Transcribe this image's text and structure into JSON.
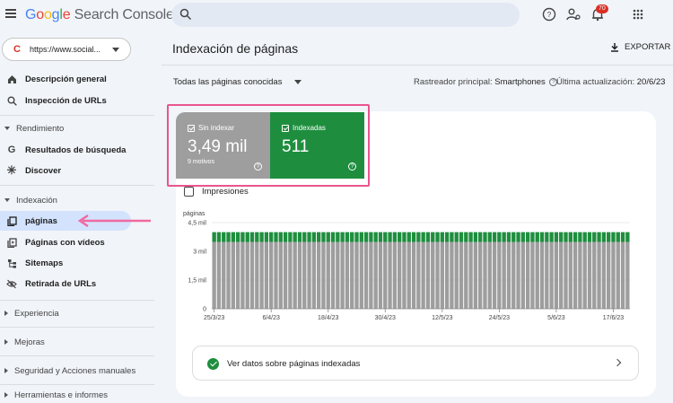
{
  "header": {
    "logo_google": "Google",
    "logo_product": "Search Console",
    "search_placeholder": "",
    "notification_count": "70"
  },
  "sidebar": {
    "property": "https://www.social...",
    "items_top": [
      {
        "label": "Descripción general",
        "icon": "home-icon"
      },
      {
        "label": "Inspección de URLs",
        "icon": "search-icon"
      }
    ],
    "section_rendimiento": "Rendimiento",
    "items_rendimiento": [
      {
        "label": "Resultados de búsqueda",
        "icon": "google-g-icon"
      },
      {
        "label": "Discover",
        "icon": "asterisk-icon"
      }
    ],
    "section_indexacion": "Indexación",
    "items_indexacion": [
      {
        "label": "páginas",
        "icon": "pages-icon"
      },
      {
        "label": "Páginas con vídeos",
        "icon": "video-pages-icon"
      },
      {
        "label": "Sitemaps",
        "icon": "sitemap-icon"
      },
      {
        "label": "Retirada de URLs",
        "icon": "eye-off-icon"
      }
    ],
    "section_experiencia": "Experiencia",
    "section_mejoras": "Mejoras",
    "section_seguridad": "Seguridad y Acciones manuales",
    "section_herramientas": "Herramientas e informes"
  },
  "main": {
    "title": "Indexación de páginas",
    "export_label": "EXPORTAR",
    "filter_label": "Todas las páginas conocidas",
    "crawler_label": "Rastreador principal:",
    "crawler_value": "Smartphones",
    "last_update_label": "Última actualización:",
    "last_update_value": "20/6/23",
    "tiles": {
      "not_indexed": {
        "label": "Sin indexar",
        "value": "3,49 mil",
        "sub": "9 motivos",
        "color": "#9e9e9e"
      },
      "indexed": {
        "label": "Indexadas",
        "value": "511",
        "color": "#1e8e3e"
      }
    },
    "impressions_label": "Impresiones",
    "link_label": "Ver datos sobre páginas indexadas"
  },
  "chart_data": {
    "type": "bar",
    "stacked": true,
    "ylabel": "páginas",
    "ytick_labels": [
      "0",
      "1,5 mil",
      "3 mil",
      "4,5 mil"
    ],
    "ytick_values": [
      0,
      1500,
      3000,
      4500
    ],
    "ylim": [
      0,
      4500
    ],
    "xtick_labels": [
      "25/3/23",
      "6/4/23",
      "18/4/23",
      "30/4/23",
      "12/5/23",
      "24/5/23",
      "5/6/23",
      "17/6/23"
    ],
    "num_days": 88,
    "series": [
      {
        "name": "Sin indexar",
        "color": "#9e9e9e",
        "value_per_day": 3490
      },
      {
        "name": "Indexadas",
        "color": "#1e8e3e",
        "value_per_day": 511
      }
    ]
  }
}
